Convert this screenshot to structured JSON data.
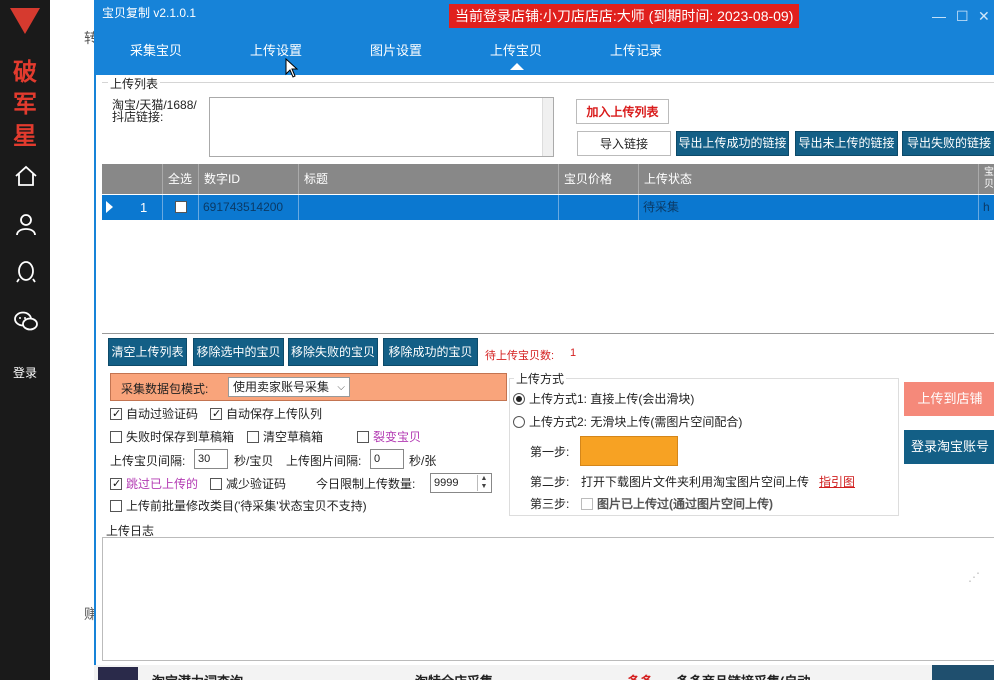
{
  "sidebar": {
    "brand_chars": [
      "破",
      "军",
      "星"
    ],
    "login_label": "登录",
    "icons": [
      "home-icon",
      "user-icon",
      "qq-icon",
      "wechat-icon"
    ]
  },
  "background": {
    "text_top": "转",
    "text_bottom": "赚"
  },
  "window": {
    "app_title": "宝贝复制 v2.1.0.1",
    "login_shop": "当前登录店铺:小刀店店店:大师 (到期时间: 2023-08-09)",
    "tabs": [
      {
        "label": "采集宝贝",
        "active": false
      },
      {
        "label": "上传设置",
        "active": false
      },
      {
        "label": "图片设置",
        "active": false
      },
      {
        "label": "上传宝贝",
        "active": true
      },
      {
        "label": "上传记录",
        "active": false
      }
    ]
  },
  "upload_list": {
    "section_label": "上传列表",
    "link_label": "淘宝/天猫/1688/抖店链接:",
    "link_value": "",
    "add_button": "加入上传列表",
    "import_button": "导入链接",
    "export_success": "导出上传成功的链接",
    "export_not_uploaded": "导出未上传的链接",
    "export_failed": "导出失败的链接"
  },
  "grid": {
    "columns": [
      "",
      "全选",
      "数字ID",
      "标题",
      "宝贝价格",
      "上传状态",
      "宝贝"
    ],
    "rows": [
      {
        "index": "1",
        "checked": false,
        "id": "691743514200",
        "title": "",
        "price": "",
        "status": "待采集",
        "extra": "h"
      }
    ]
  },
  "actions": {
    "clear": "清空上传列表",
    "remove_selected": "移除选中的宝贝",
    "remove_failed": "移除失败的宝贝",
    "remove_success": "移除成功的宝贝",
    "pending_label": "待上传宝贝数:",
    "pending_count": "1"
  },
  "settings": {
    "mode_label": "采集数据包模式:",
    "mode_value": "使用卖家账号采集",
    "auto_captcha": {
      "label": "自动过验证码",
      "checked": true
    },
    "auto_save_queue": {
      "label": "自动保存上传队列",
      "checked": true
    },
    "save_draft_on_fail": {
      "label": "失败时保存到草稿箱",
      "checked": false
    },
    "clear_drafts": {
      "label": "清空草稿箱",
      "checked": false
    },
    "split_item": {
      "label": "裂变宝贝",
      "checked": false
    },
    "interval_label": "上传宝贝间隔:",
    "interval_value": "30",
    "interval_unit": "秒/宝贝",
    "img_interval_label": "上传图片间隔:",
    "img_interval_value": "0",
    "img_interval_unit": "秒/张",
    "skip_uploaded": {
      "label": "跳过已上传的",
      "checked": true
    },
    "reduce_captcha": {
      "label": "减少验证码",
      "checked": false
    },
    "daily_limit_label": "今日限制上传数量:",
    "daily_limit_value": "9999",
    "batch_modify": {
      "label": "上传前批量修改类目('待采集'状态宝贝不支持)",
      "checked": false
    }
  },
  "upload_method": {
    "title": "上传方式",
    "option1": "上传方式1: 直接上传(会出滑块)",
    "option2": "上传方式2: 无滑块上传(需图片空间配合)",
    "selected": 1,
    "step1_label": "第一步:",
    "step2_label": "第二步:",
    "step2_text": "打开下载图片文件夹利用淘宝图片空间上传",
    "guide_link": "指引图",
    "step3_label": "第三步:",
    "step3_text": "图片已上传过(通过图片空间上传)",
    "step3_checked": false
  },
  "buttons": {
    "upload_store": "上传到店铺",
    "login_taobao": "登录淘宝账号"
  },
  "log": {
    "label": "上传日志",
    "content": ""
  },
  "bottom_strip": {
    "text1": "淘宝潜力词查询",
    "text2": "淘特全店采集",
    "text3": "多多",
    "text4": "多多商品链接采集(自动"
  },
  "colors": {
    "title_blue": "#1783d8",
    "btn_blue": "#135f86",
    "shop_red": "#e0201d",
    "selection_blue": "#0b78d0",
    "orange": "#f9a47b"
  }
}
